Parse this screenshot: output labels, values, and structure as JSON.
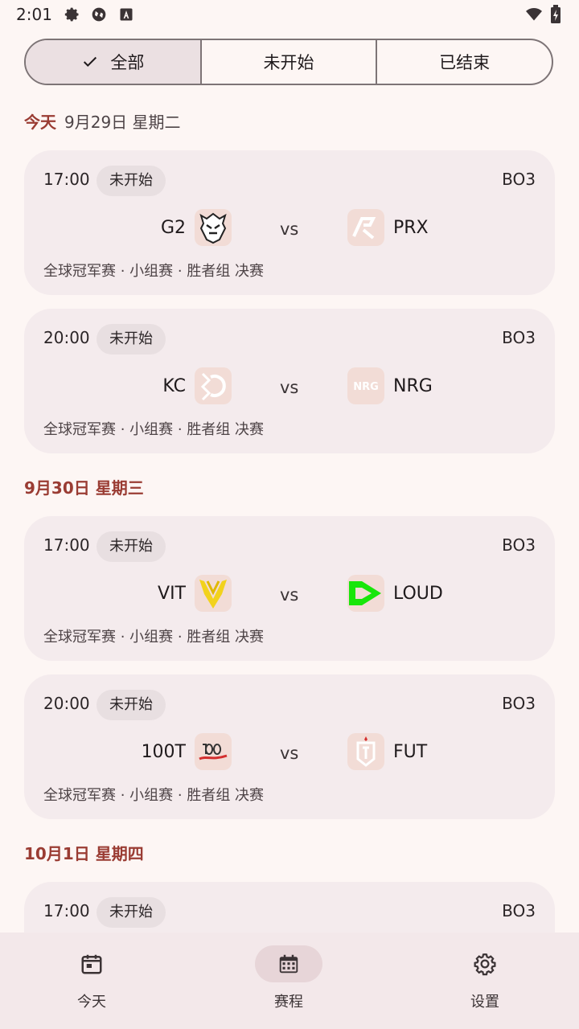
{
  "status_bar": {
    "time": "2:01"
  },
  "filters": [
    {
      "label": "全部",
      "selected": true
    },
    {
      "label": "未开始",
      "selected": false
    },
    {
      "label": "已结束",
      "selected": false
    }
  ],
  "days": [
    {
      "label": "今天",
      "date": "9月29日 星期二",
      "matches": [
        {
          "time": "17:00",
          "status": "未开始",
          "format": "BO3",
          "team_a": "G2",
          "team_b": "PRX",
          "stage": "全球冠军赛 · 小组赛 · 胜者组 决赛"
        },
        {
          "time": "20:00",
          "status": "未开始",
          "format": "BO3",
          "team_a": "KC",
          "team_b": "NRG",
          "stage": "全球冠军赛 · 小组赛 · 胜者组 决赛"
        }
      ]
    },
    {
      "label": "9月30日 星期三",
      "matches": [
        {
          "time": "17:00",
          "status": "未开始",
          "format": "BO3",
          "team_a": "VIT",
          "team_b": "LOUD",
          "stage": "全球冠军赛 · 小组赛 · 胜者组 决赛"
        },
        {
          "time": "20:00",
          "status": "未开始",
          "format": "BO3",
          "team_a": "100T",
          "team_b": "FUT",
          "stage": "全球冠军赛 · 小组赛 · 胜者组 决赛"
        }
      ]
    },
    {
      "label": "10月1日 星期四",
      "matches": [
        {
          "time": "17:00",
          "status": "未开始",
          "format": "BO3"
        }
      ]
    }
  ],
  "vs_label": "vs",
  "bottom_nav": [
    {
      "label": "今天",
      "icon": "calendar-today-icon",
      "active": false
    },
    {
      "label": "赛程",
      "icon": "calendar-month-icon",
      "active": true
    },
    {
      "label": "设置",
      "icon": "gear-icon",
      "active": false
    }
  ],
  "colors": {
    "accent": "#9a3c33",
    "card": "#f4ebed",
    "background": "#fdf6f4"
  }
}
